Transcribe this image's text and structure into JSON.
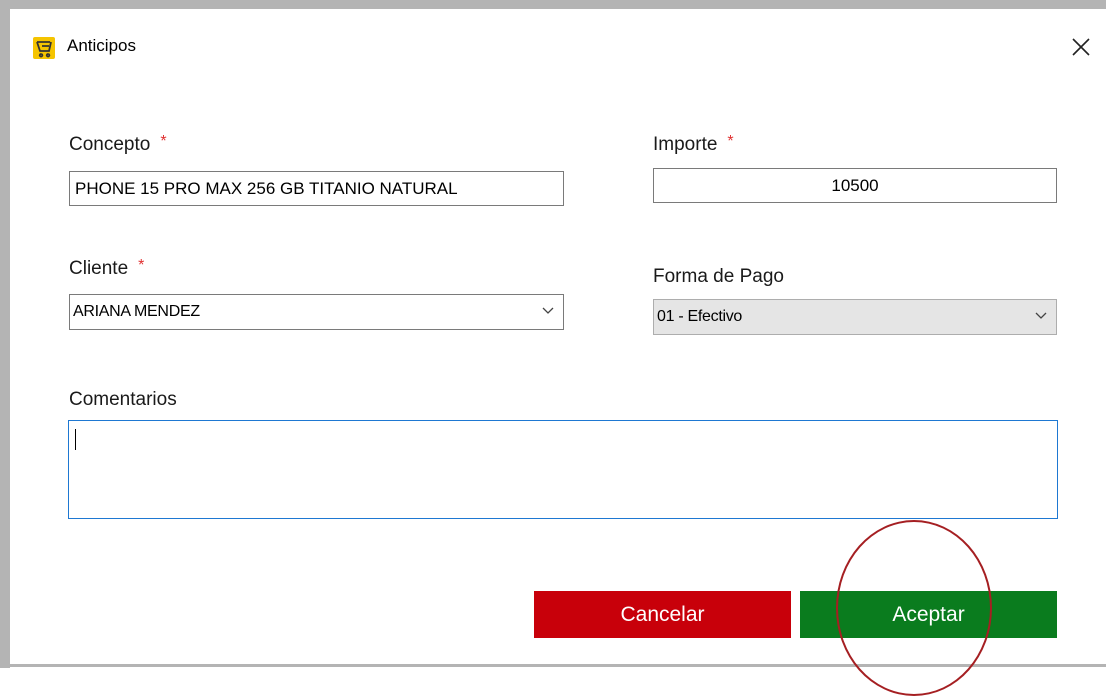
{
  "window": {
    "title": "Anticipos"
  },
  "form": {
    "concepto": {
      "label": "Concepto",
      "required_mark": "*",
      "value": "PHONE 15 PRO MAX 256 GB TITANIO NATURAL"
    },
    "importe": {
      "label": "Importe",
      "required_mark": "*",
      "value": "10500"
    },
    "cliente": {
      "label": "Cliente",
      "required_mark": "*",
      "selected": "ARIANA MENDEZ"
    },
    "forma_pago": {
      "label": "Forma de Pago",
      "selected": "01 - Efectivo"
    },
    "comentarios": {
      "label": "Comentarios",
      "value": ""
    }
  },
  "buttons": {
    "cancel_label": "Cancelar",
    "accept_label": "Aceptar"
  },
  "colors": {
    "cancel": "#c8000a",
    "accept": "#0a7c1e",
    "highlight_circle": "#a51f22",
    "required": "#e03030"
  },
  "icons": {
    "app": "cash-register-icon",
    "close": "close-icon",
    "dropdown": "chevron-down-icon"
  }
}
